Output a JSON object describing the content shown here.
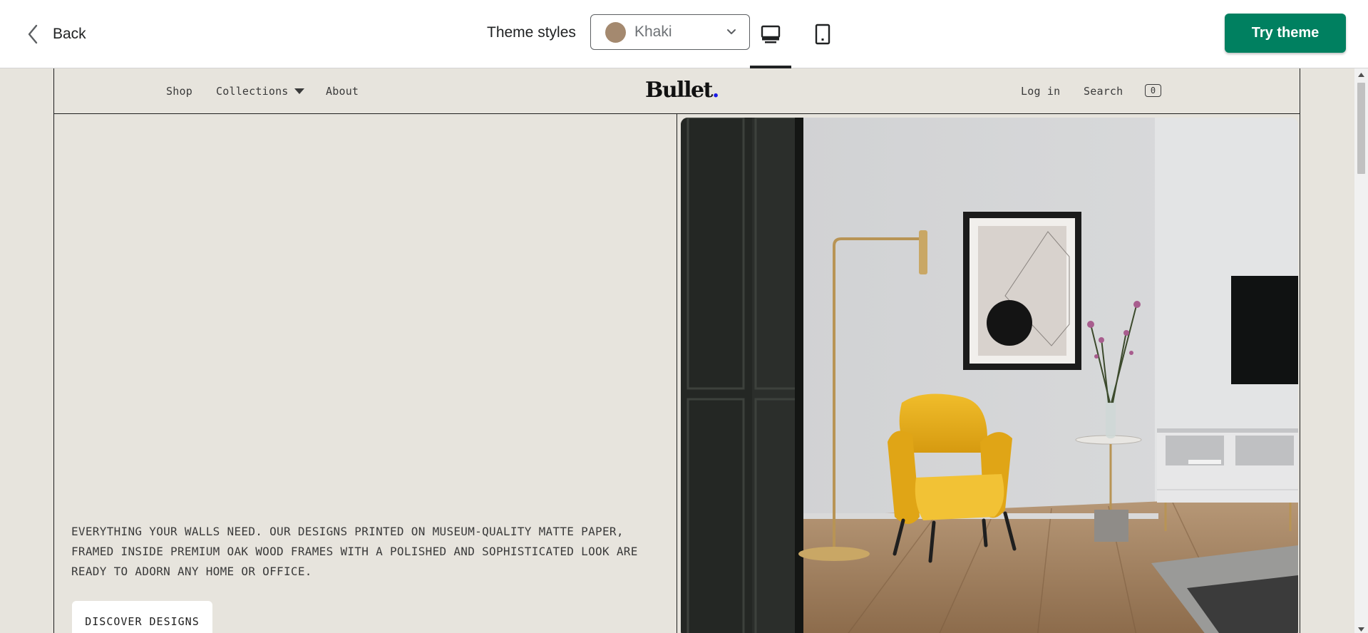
{
  "topbar": {
    "back_label": "Back",
    "theme_styles_label": "Theme styles",
    "theme_select": {
      "value": "Khaki",
      "swatch_color": "#a4896f"
    },
    "devices": [
      {
        "name": "desktop",
        "icon": "desktop-icon",
        "selected": true
      },
      {
        "name": "mobile",
        "icon": "mobile-icon",
        "selected": false
      }
    ],
    "try_theme_label": "Try theme",
    "accent_color": "#008060"
  },
  "store": {
    "nav": {
      "shop": "Shop",
      "collections": "Collections",
      "about": "About",
      "logo_text": "Bullet",
      "logo_dot": ".",
      "login": "Log in",
      "search": "Search",
      "cart_count": "0"
    },
    "hero": {
      "text": "EVERYTHING YOUR WALLS NEED. OUR DESIGNS PRINTED ON MUSEUM-QUALITY MATTE PAPER, FRAMED INSIDE PREMIUM OAK WOOD FRAMES WITH A POLISHED AND SOPHISTICATED LOOK ARE READY TO ADORN ANY HOME OR OFFICE.",
      "button_label": "DISCOVER DESIGNS"
    },
    "background_color": "#e7e4dd"
  }
}
